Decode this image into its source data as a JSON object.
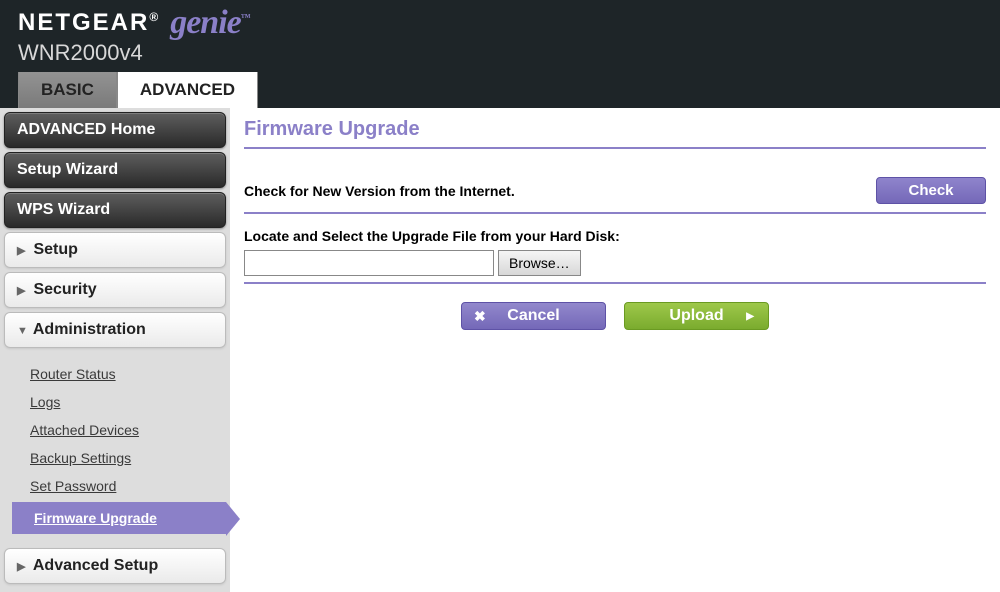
{
  "header": {
    "brand": "NETGEAR",
    "product": "genie",
    "tm": "™",
    "reg": "®",
    "model": "WNR2000v4"
  },
  "tabs": {
    "basic": "BASIC",
    "advanced": "ADVANCED"
  },
  "sidebar": {
    "advanced_home": "ADVANCED Home",
    "setup_wizard": "Setup Wizard",
    "wps_wizard": "WPS Wizard",
    "setup": "Setup",
    "security": "Security",
    "administration": "Administration",
    "admin_items": {
      "router_status": "Router Status",
      "logs": "Logs",
      "attached_devices": "Attached Devices",
      "backup_settings": "Backup Settings",
      "set_password": "Set Password",
      "firmware_upgrade": "Firmware Upgrade"
    },
    "advanced_setup": "Advanced Setup"
  },
  "content": {
    "title": "Firmware Upgrade",
    "check_label": "Check for New Version from the Internet.",
    "check_button": "Check",
    "locate_label": "Locate and Select the Upgrade File from your Hard Disk:",
    "browse_button": "Browse…",
    "cancel_button": "Cancel",
    "upload_button": "Upload",
    "file_value": ""
  }
}
